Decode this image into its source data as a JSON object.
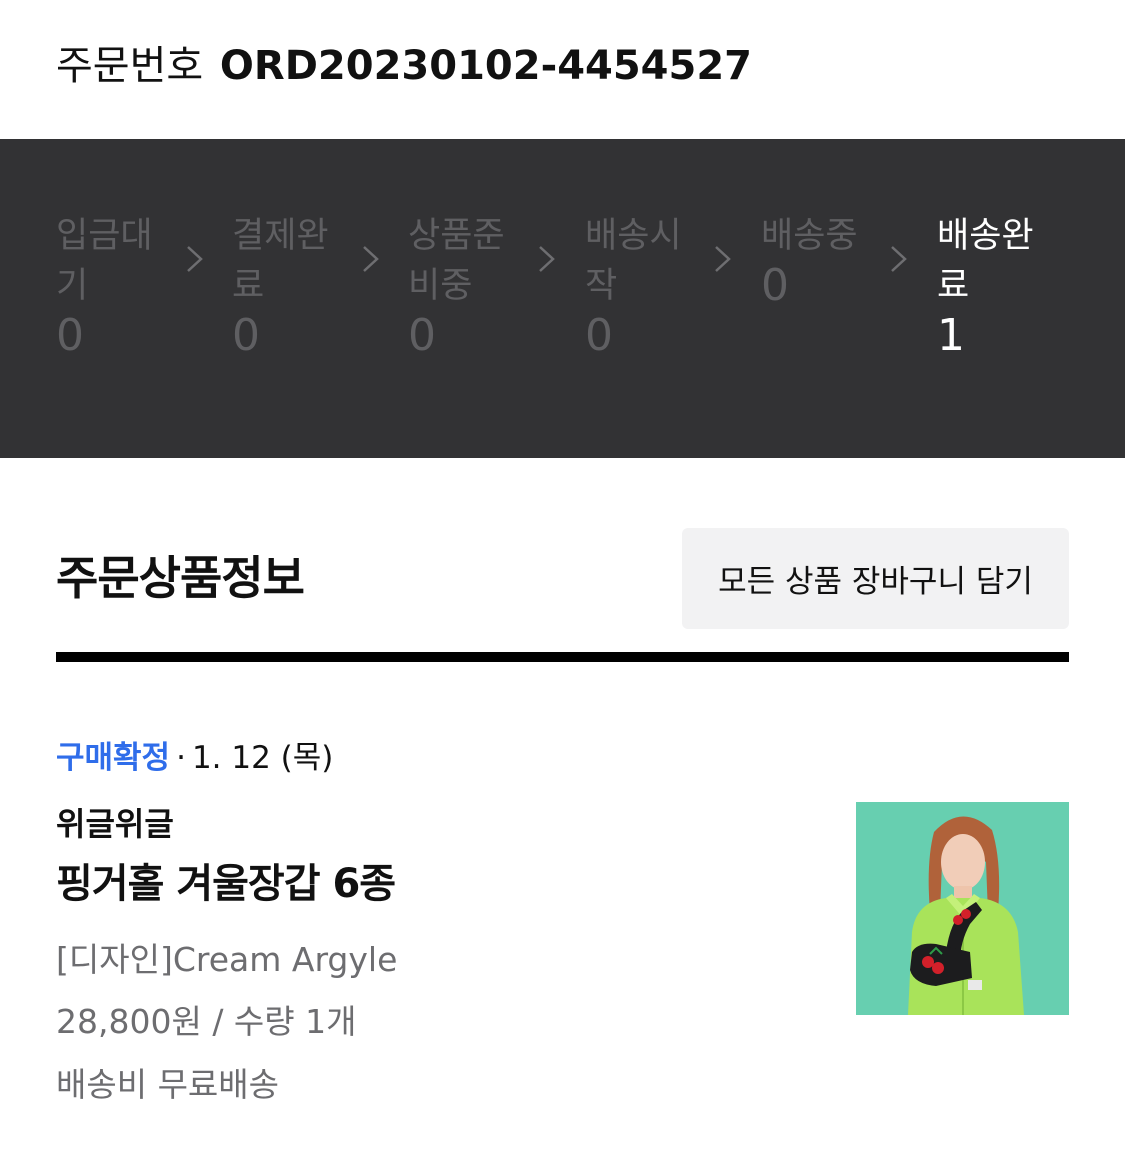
{
  "order": {
    "label": "주문번호",
    "number": "ORD20230102-4454527"
  },
  "status_steps": [
    {
      "label": "입금대기",
      "count": "0",
      "active": false
    },
    {
      "label": "결제완료",
      "count": "0",
      "active": false
    },
    {
      "label": "상품준비중",
      "count": "0",
      "active": false
    },
    {
      "label": "배송시작",
      "count": "0",
      "active": false
    },
    {
      "label": "배송중",
      "count": "0",
      "active": false
    },
    {
      "label": "배송완료",
      "count": "1",
      "active": true
    }
  ],
  "section": {
    "title": "주문상품정보",
    "cart_button": "모든 상품 장바구니 담기"
  },
  "item": {
    "status": "구매확정",
    "date": "1. 12 (목)",
    "brand": "위글위글",
    "name": "핑거홀 겨울장갑 6종",
    "option": "[디자인]Cream Argyle",
    "price": "28,800원 / 수량 1개",
    "shipping": "배송비 무료배송"
  },
  "colors": {
    "status_bar_bg": "#323234",
    "inactive_step": "#5f5f62",
    "active_step": "#ffffff",
    "confirm_blue": "#2f6dea",
    "thumb_bg": "#67cfb0"
  },
  "icons": {
    "step_separator": "chevron-right-icon",
    "product_image": "product-thumbnail"
  }
}
